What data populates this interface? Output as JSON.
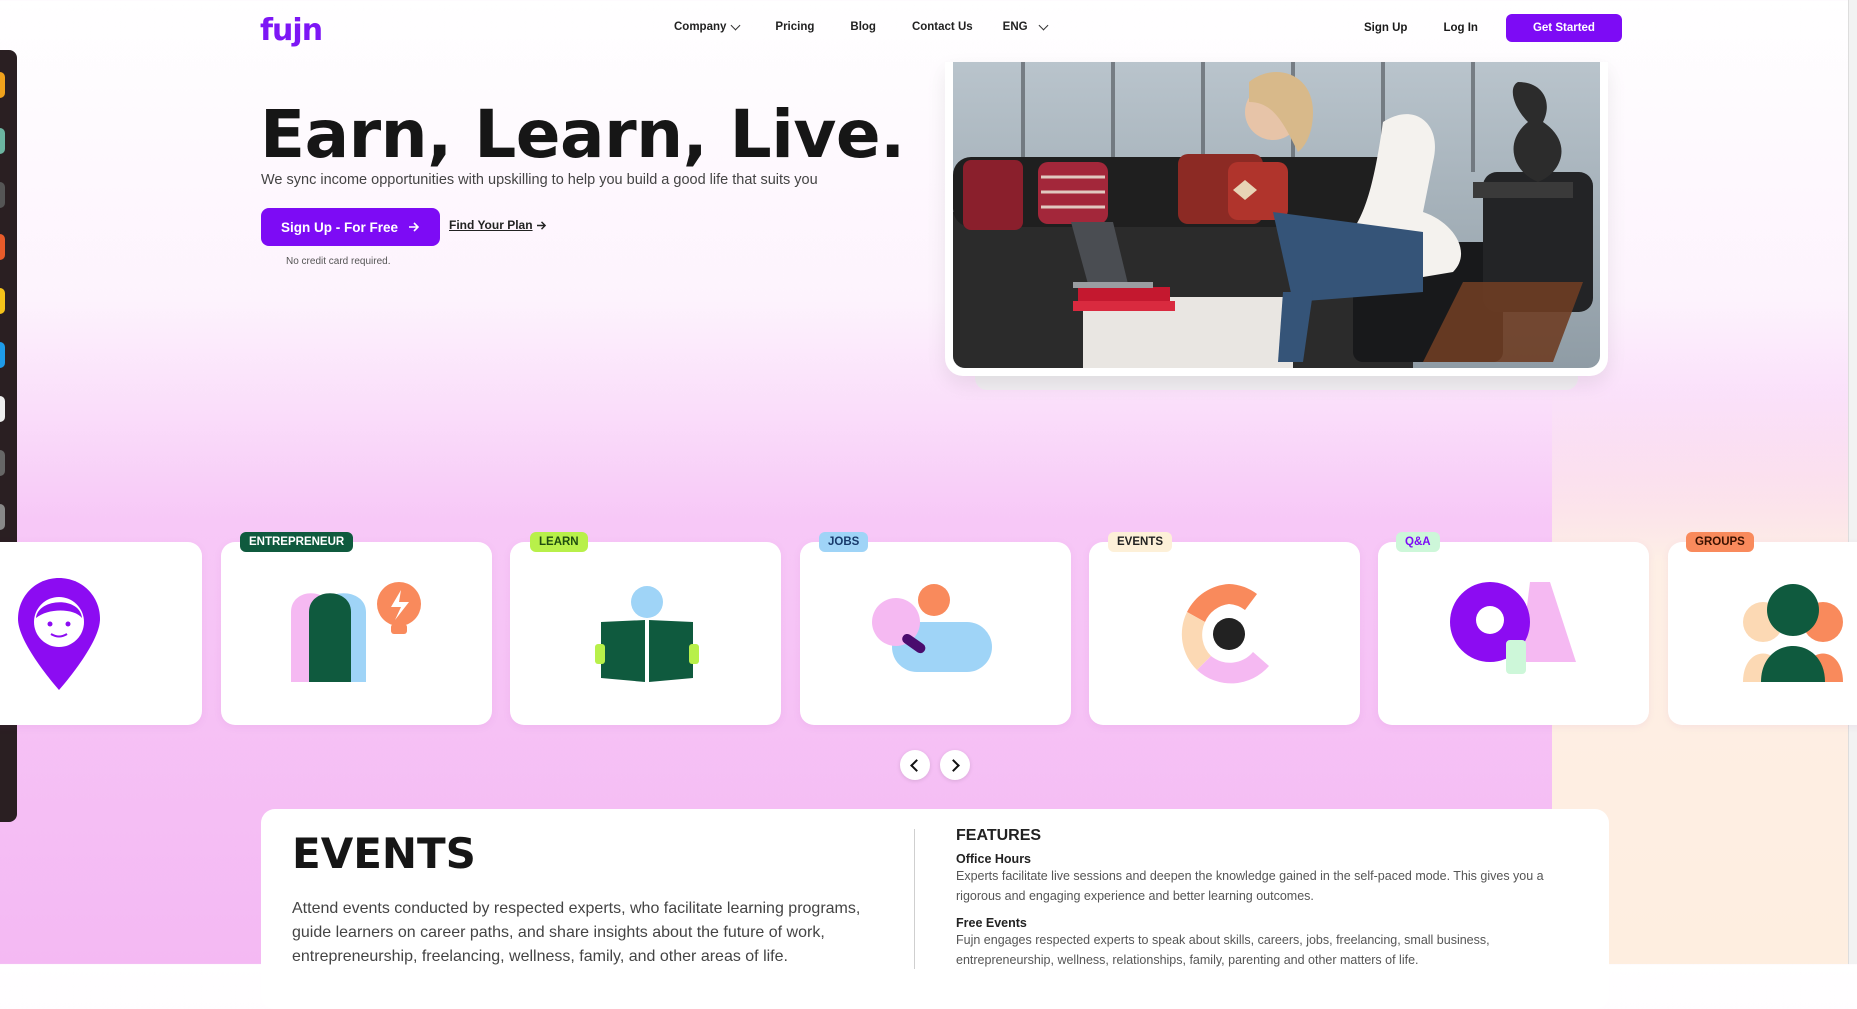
{
  "header": {
    "logo": "fujn",
    "nav": [
      {
        "label": "Company",
        "has_dropdown": true
      },
      {
        "label": "Pricing",
        "has_dropdown": false
      },
      {
        "label": "Blog",
        "has_dropdown": false
      },
      {
        "label": "Contact Us",
        "has_dropdown": false
      },
      {
        "label": "ENG",
        "has_dropdown": true
      }
    ],
    "sign_up": "Sign Up",
    "log_in": "Log In",
    "get_started": "Get Started"
  },
  "hero": {
    "title": "Earn, Learn, Live.",
    "subtitle": "We sync income opportunities with upskilling to help you build a good life that suits you",
    "cta_label": "Sign Up - For Free",
    "plan_link": "Find Your Plan",
    "note": "No credit card required."
  },
  "categories": [
    {
      "label": "",
      "icon": "profile-pin-icon"
    },
    {
      "label": "ENTREPRENEUR",
      "icon": "entrepreneur-idea-icon",
      "badge_bg": "#0f5a3e",
      "badge_fg": "#ffffff"
    },
    {
      "label": "LEARN",
      "icon": "open-book-icon",
      "badge_bg": "#b8f04a",
      "badge_fg": "#1f4d10"
    },
    {
      "label": "JOBS",
      "icon": "job-search-icon",
      "badge_bg": "#9fd4f7",
      "badge_fg": "#183a6b"
    },
    {
      "label": "EVENTS",
      "icon": "events-ring-icon",
      "badge_bg": "#fdf0d8",
      "badge_fg": "#222222"
    },
    {
      "label": "Q&A",
      "icon": "qa-shapes-icon",
      "badge_bg": "#cdf7d9",
      "badge_fg": "#7d0bf5"
    },
    {
      "label": "GROUPS",
      "icon": "groups-people-icon",
      "badge_bg": "#f98a5c",
      "badge_fg": "#3a1100"
    }
  ],
  "carousel": {
    "prev_icon": "chevron-left-icon",
    "next_icon": "chevron-right-icon"
  },
  "events": {
    "title": "EVENTS",
    "description": "Attend events conducted by respected experts, who facilitate learning programs, guide learners on career paths, and share insights about the future of work, entrepreneurship, freelancing, wellness, family, and other areas of life.",
    "features_heading": "FEATURES",
    "features": [
      {
        "title": "Office Hours",
        "body": "Experts facilitate live sessions and deepen the knowledge gained in the self-paced mode. This gives you a rigorous and engaging experience and better learning outcomes."
      },
      {
        "title": "Free Events",
        "body": "Fujn engages respected experts to speak about skills, careers, jobs, freelancing, small business, entrepreneurship, wellness, relationships, family, parenting and other matters of life."
      }
    ]
  },
  "colors": {
    "brand": "#7d0bf5",
    "text": "#161616"
  }
}
